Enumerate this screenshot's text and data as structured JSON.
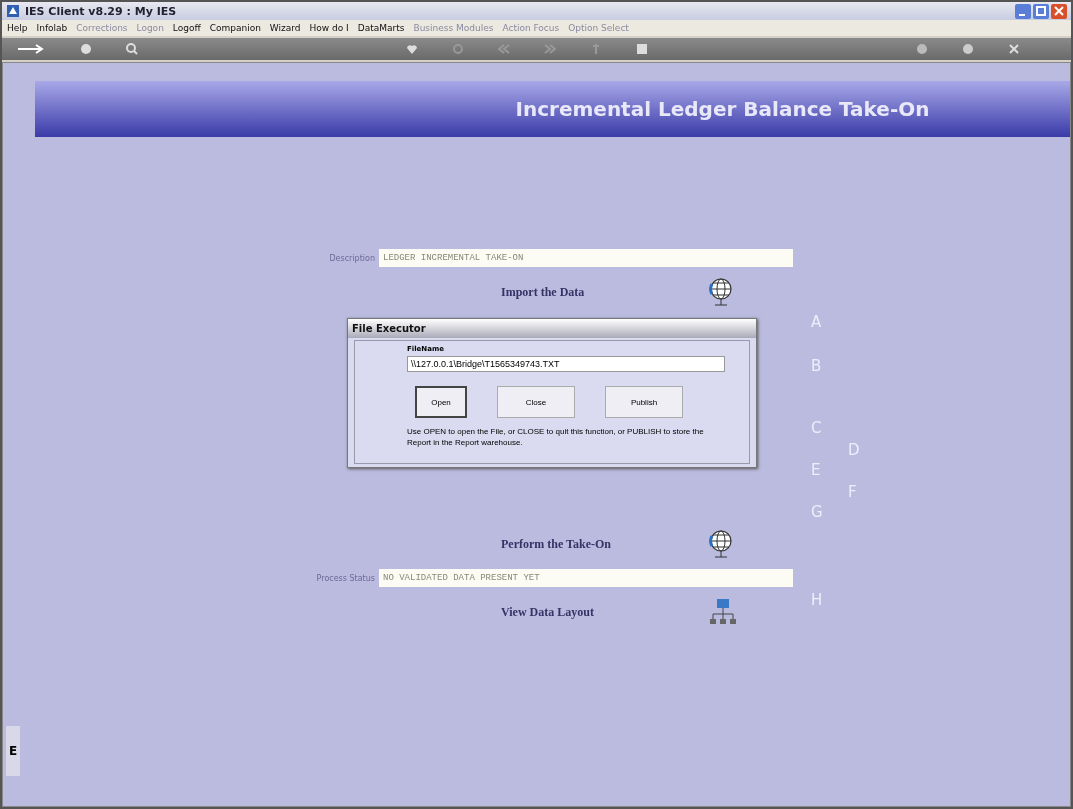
{
  "window": {
    "title": "IES Client v8.29 : My IES"
  },
  "menu": [
    {
      "label": "Help",
      "disabled": false
    },
    {
      "label": "Infolab",
      "disabled": false
    },
    {
      "label": "Corrections",
      "disabled": true
    },
    {
      "label": "Logon",
      "disabled": true
    },
    {
      "label": "Logoff",
      "disabled": false
    },
    {
      "label": "Companion",
      "disabled": false
    },
    {
      "label": "Wizard",
      "disabled": false
    },
    {
      "label": "How do I",
      "disabled": false
    },
    {
      "label": "DataMarts",
      "disabled": false
    },
    {
      "label": "Business Modules",
      "disabled": true
    },
    {
      "label": "Action Focus",
      "disabled": true
    },
    {
      "label": "Option Select",
      "disabled": true
    }
  ],
  "banner": {
    "title": "Incremental Ledger Balance Take-On"
  },
  "rows": [
    {
      "kind": "field",
      "label": "Description",
      "value": "LEDGER INCREMENTAL TAKE-ON"
    },
    {
      "kind": "action",
      "label": "Import the Data"
    },
    {
      "kind": "gap"
    },
    {
      "kind": "action",
      "label": "Perform the Take-On"
    },
    {
      "kind": "field",
      "label": "Process Status",
      "value": "NO VALIDATED DATA PRESENT YET"
    },
    {
      "kind": "layout",
      "label": "View Data Layout"
    }
  ],
  "steps": [
    "A",
    "B",
    "C",
    "D",
    "E",
    "F",
    "G",
    "H"
  ],
  "side_tab": {
    "label": "E"
  },
  "dialog": {
    "title": "File Executor",
    "field_label": "FileName",
    "field_value": "\\\\127.0.0.1\\Bridge\\T1565349743.TXT",
    "buttons": [
      {
        "label": "Open",
        "selected": true
      },
      {
        "label": "Close",
        "selected": false
      },
      {
        "label": "Publish",
        "selected": false
      }
    ],
    "hint": "Use OPEN to open the File, or CLOSE to quit this function, or PUBLISH to store the Report in the Report warehouse."
  }
}
